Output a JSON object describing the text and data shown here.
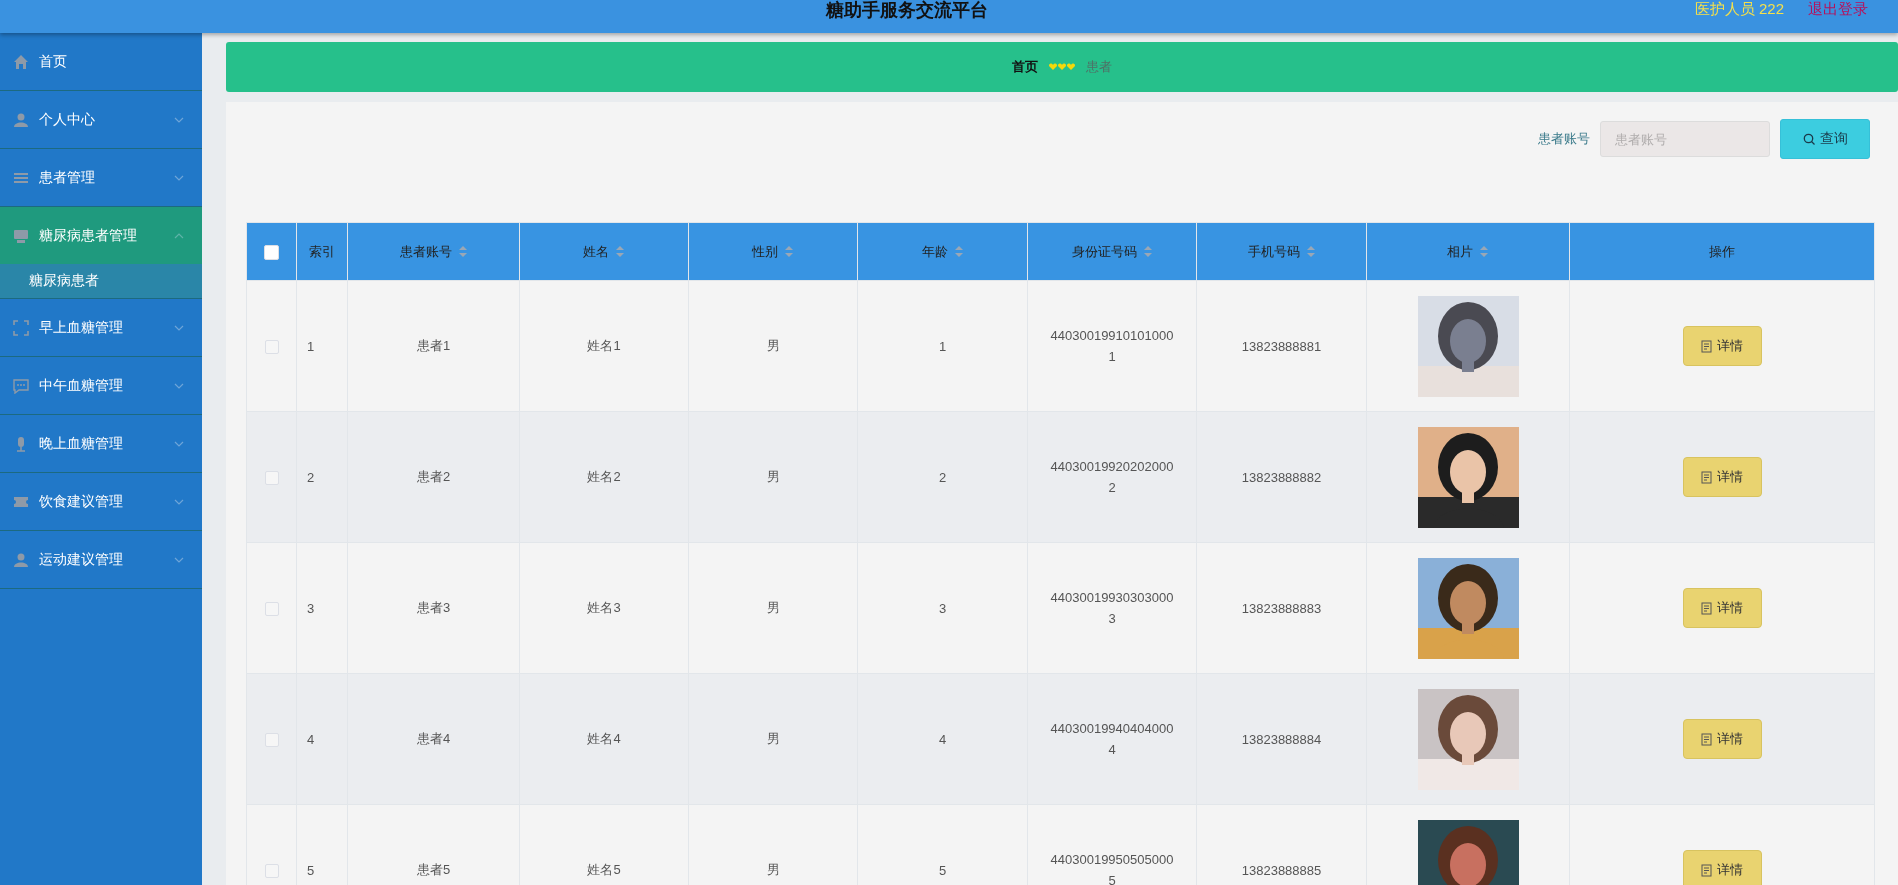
{
  "header": {
    "title": "糖助手服务交流平台",
    "user": "医护人员 222",
    "logout": "退出登录"
  },
  "sidebar": {
    "items": [
      {
        "label": "首页",
        "expanded": false,
        "has_children": false
      },
      {
        "label": "个人中心",
        "expanded": false,
        "has_children": true
      },
      {
        "label": "患者管理",
        "expanded": false,
        "has_children": true
      },
      {
        "label": "糖尿病患者管理",
        "expanded": true,
        "has_children": true,
        "children": [
          {
            "label": "糖尿病患者",
            "selected": true
          }
        ]
      },
      {
        "label": "早上血糖管理",
        "expanded": false,
        "has_children": true
      },
      {
        "label": "中午血糖管理",
        "expanded": false,
        "has_children": true
      },
      {
        "label": "晚上血糖管理",
        "expanded": false,
        "has_children": true
      },
      {
        "label": "饮食建议管理",
        "expanded": false,
        "has_children": true
      },
      {
        "label": "运动建议管理",
        "expanded": false,
        "has_children": true
      }
    ]
  },
  "breadcrumb": [
    {
      "label": "首页",
      "current": false
    },
    {
      "label": "患者",
      "current": true
    }
  ],
  "search": {
    "label": "患者账号",
    "placeholder": "患者账号",
    "button": "查询"
  },
  "table": {
    "select_all_checked": false,
    "columns": [
      {
        "label": "索引",
        "sortable": false
      },
      {
        "label": "患者账号",
        "sortable": true
      },
      {
        "label": "姓名",
        "sortable": true
      },
      {
        "label": "性别",
        "sortable": true
      },
      {
        "label": "年龄",
        "sortable": true
      },
      {
        "label": "身份证号码",
        "sortable": true
      },
      {
        "label": "手机号码",
        "sortable": true
      },
      {
        "label": "相片",
        "sortable": true
      },
      {
        "label": "操作",
        "sortable": false
      }
    ],
    "rows": [
      {
        "checked": false,
        "cells": [
          "1",
          "患者1",
          "姓名1",
          "男",
          "1",
          "440300199101010001",
          "13823888881"
        ],
        "action": "详情"
      },
      {
        "checked": false,
        "cells": [
          "2",
          "患者2",
          "姓名2",
          "男",
          "2",
          "440300199202020002",
          "13823888882"
        ],
        "action": "详情"
      },
      {
        "checked": false,
        "cells": [
          "3",
          "患者3",
          "姓名3",
          "男",
          "3",
          "440300199303030003",
          "13823888883"
        ],
        "action": "详情"
      },
      {
        "checked": false,
        "cells": [
          "4",
          "患者4",
          "姓名4",
          "男",
          "4",
          "440300199404040004",
          "13823888884"
        ],
        "action": "详情"
      },
      {
        "checked": false,
        "cells": [
          "5",
          "患者5",
          "姓名5",
          "男",
          "5",
          "440300199505050005",
          "13823888885"
        ],
        "action": "详情"
      }
    ]
  }
}
